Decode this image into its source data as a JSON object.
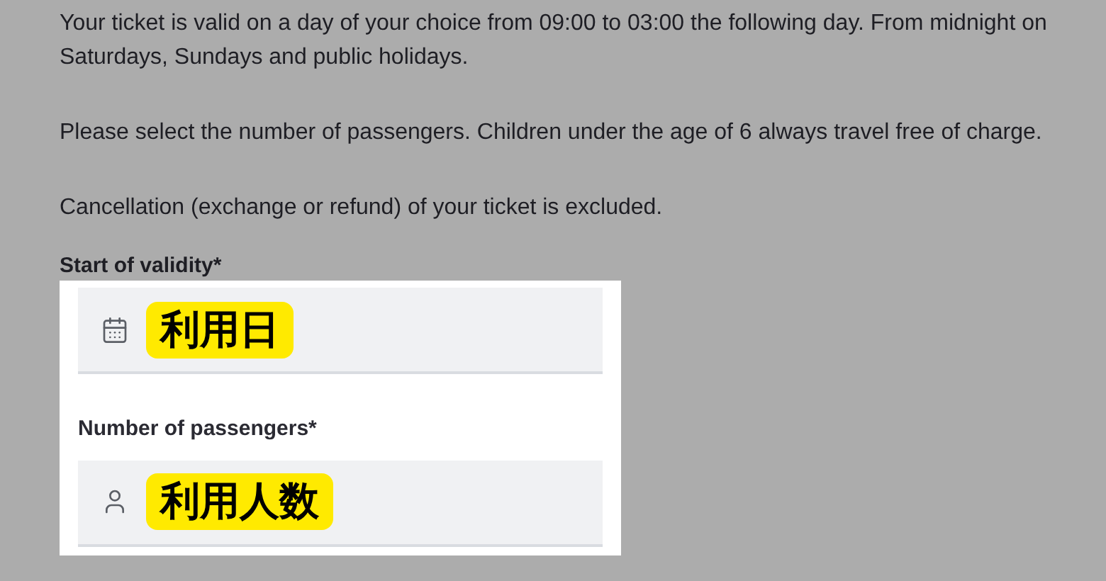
{
  "paragraphs": [
    "Your ticket is valid on a day of your choice from 09:00 to 03:00 the following day. From midnight on Saturdays, Sundays and public holidays.",
    "Please select the number of passengers. Children under the age of 6 always travel free of charge.",
    "Cancellation (exchange or refund) of your ticket is excluded."
  ],
  "fields": [
    {
      "kind": "date",
      "label": "Start of validity*",
      "annotation": "利用日"
    },
    {
      "kind": "passengers",
      "label": "Number of passengers*",
      "annotation": "利用人数"
    }
  ]
}
